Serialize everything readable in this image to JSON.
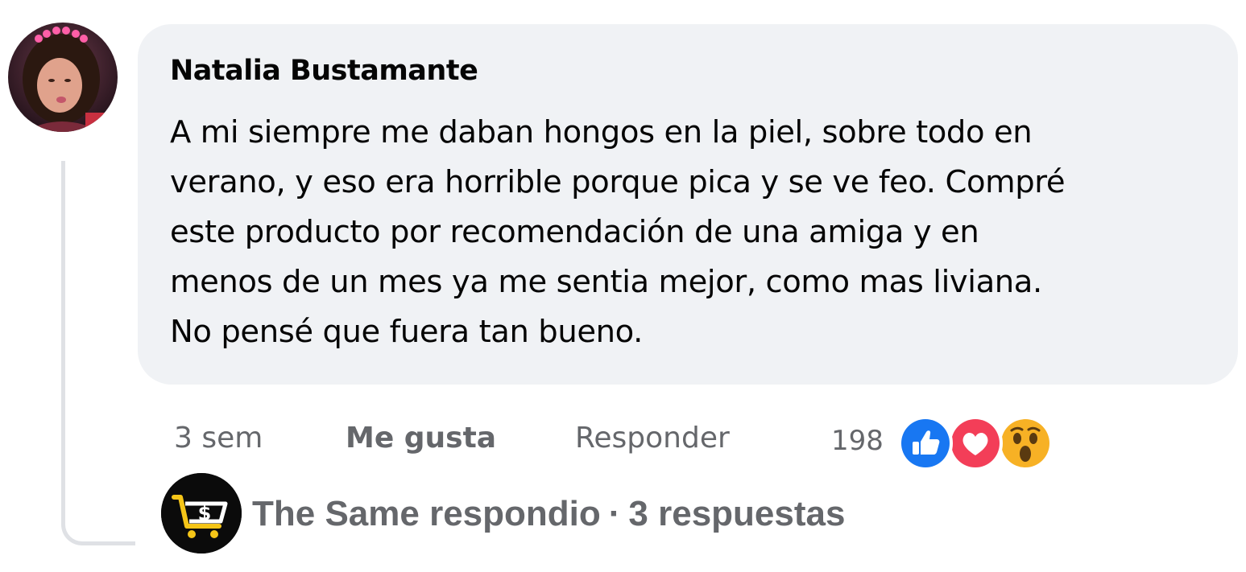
{
  "comment": {
    "author": "Natalia Bustamante",
    "lines": [
      "A mi siempre me daban hongos en la piel, sobre todo en",
      "verano, y eso era horrible porque pica y se ve feo. Compré",
      "este producto por recomendación de una amiga y en",
      "menos de un mes ya me sentia mejor, como mas liviana.",
      "No pensé que fuera tan bueno."
    ],
    "time": "3 sem",
    "like_label": "Me gusta",
    "reply_label": "Responder",
    "reaction_count": "198",
    "reactions": [
      "like-icon",
      "love-icon",
      "wow-icon"
    ]
  },
  "replies": {
    "author_text": "The Same respondio",
    "separator": "·",
    "count_text": "3 respuestas"
  },
  "colors": {
    "bubble": "#f0f2f5",
    "text": "#050505",
    "muted": "#65676b",
    "like": "#1877f2",
    "love": "#f33e58",
    "wow": "#f7b125",
    "brand_yellow": "#f5c518"
  }
}
